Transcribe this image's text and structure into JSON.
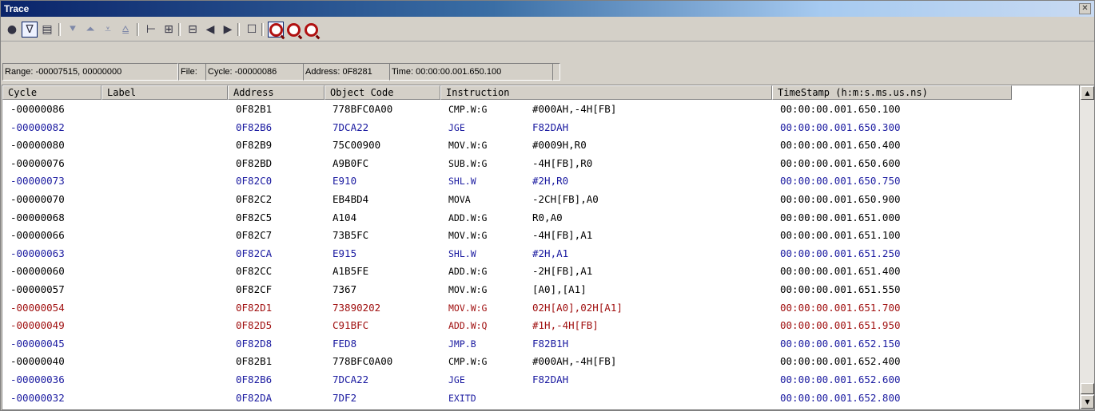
{
  "window": {
    "title": "Trace",
    "close_glyph": "✕"
  },
  "toolbar": {
    "buttons": [
      {
        "name": "record-icon",
        "glyph": "●"
      },
      {
        "name": "filter-icon",
        "glyph": "∇"
      },
      {
        "name": "document-icon",
        "glyph": "▤"
      },
      {
        "name": "step-down-icon",
        "glyph": "⯆"
      },
      {
        "name": "step-up-icon",
        "glyph": "⏶"
      },
      {
        "name": "jump-bottom-icon",
        "glyph": "⩡"
      },
      {
        "name": "jump-top-icon",
        "glyph": "⩠"
      },
      {
        "name": "source-tree-icon",
        "glyph": "⊢"
      },
      {
        "name": "tabular-icon",
        "glyph": "⊞"
      },
      {
        "name": "collapse-icon",
        "glyph": "⊟"
      },
      {
        "name": "prev-icon",
        "glyph": "◀"
      },
      {
        "name": "next-icon",
        "glyph": "▶"
      },
      {
        "name": "properties-icon",
        "glyph": "☐"
      },
      {
        "name": "find-icon",
        "glyph": ""
      },
      {
        "name": "find-prev-icon",
        "glyph": ""
      },
      {
        "name": "find-next-icon",
        "glyph": ""
      }
    ]
  },
  "status": {
    "range": "Range: -00007515, 00000000",
    "file": "File:",
    "cycle": "Cycle: -00000086",
    "address": "Address: 0F8281",
    "time": "Time: 00:00:00.001.650.100"
  },
  "columns": [
    "Cycle",
    "Label",
    "Address",
    "Object Code",
    "Instruction",
    "TimeStamp (h:m:s.ms.us.ns)"
  ],
  "colors": {
    "normal": "#000000",
    "branch": "#1a1aa0",
    "highlight": "#a01010"
  },
  "rows": [
    {
      "cycle": "-00000086",
      "label": "",
      "address": "0F82B1",
      "object": "778BFC0A00",
      "mnemonic": "CMP.W:G",
      "operand": "#000AH,-4H[FB]",
      "timestamp": "00:00:00.001.650.100",
      "style": "normal"
    },
    {
      "cycle": "-00000082",
      "label": "",
      "address": "0F82B6",
      "object": "7DCA22",
      "mnemonic": "JGE",
      "operand": "F82DAH",
      "timestamp": "00:00:00.001.650.300",
      "style": "branch"
    },
    {
      "cycle": "-00000080",
      "label": "",
      "address": "0F82B9",
      "object": "75C00900",
      "mnemonic": "MOV.W:G",
      "operand": "#0009H,R0",
      "timestamp": "00:00:00.001.650.400",
      "style": "normal"
    },
    {
      "cycle": "-00000076",
      "label": "",
      "address": "0F82BD",
      "object": "A9B0FC",
      "mnemonic": "SUB.W:G",
      "operand": "-4H[FB],R0",
      "timestamp": "00:00:00.001.650.600",
      "style": "normal"
    },
    {
      "cycle": "-00000073",
      "label": "",
      "address": "0F82C0",
      "object": "E910",
      "mnemonic": "SHL.W",
      "operand": "#2H,R0",
      "timestamp": "00:00:00.001.650.750",
      "style": "branch"
    },
    {
      "cycle": "-00000070",
      "label": "",
      "address": "0F82C2",
      "object": "EB4BD4",
      "mnemonic": "MOVA",
      "operand": "-2CH[FB],A0",
      "timestamp": "00:00:00.001.650.900",
      "style": "normal"
    },
    {
      "cycle": "-00000068",
      "label": "",
      "address": "0F82C5",
      "object": "A104",
      "mnemonic": "ADD.W:G",
      "operand": "R0,A0",
      "timestamp": "00:00:00.001.651.000",
      "style": "normal"
    },
    {
      "cycle": "-00000066",
      "label": "",
      "address": "0F82C7",
      "object": "73B5FC",
      "mnemonic": "MOV.W:G",
      "operand": "-4H[FB],A1",
      "timestamp": "00:00:00.001.651.100",
      "style": "normal"
    },
    {
      "cycle": "-00000063",
      "label": "",
      "address": "0F82CA",
      "object": "E915",
      "mnemonic": "SHL.W",
      "operand": "#2H,A1",
      "timestamp": "00:00:00.001.651.250",
      "style": "branch"
    },
    {
      "cycle": "-00000060",
      "label": "",
      "address": "0F82CC",
      "object": "A1B5FE",
      "mnemonic": "ADD.W:G",
      "operand": "-2H[FB],A1",
      "timestamp": "00:00:00.001.651.400",
      "style": "normal"
    },
    {
      "cycle": "-00000057",
      "label": "",
      "address": "0F82CF",
      "object": "7367",
      "mnemonic": "MOV.W:G",
      "operand": "[A0],[A1]",
      "timestamp": "00:00:00.001.651.550",
      "style": "normal"
    },
    {
      "cycle": "-00000054",
      "label": "",
      "address": "0F82D1",
      "object": "73890202",
      "mnemonic": "MOV.W:G",
      "operand": "02H[A0],02H[A1]",
      "timestamp": "00:00:00.001.651.700",
      "style": "highlight"
    },
    {
      "cycle": "-00000049",
      "label": "",
      "address": "0F82D5",
      "object": "C91BFC",
      "mnemonic": "ADD.W:Q",
      "operand": "#1H,-4H[FB]",
      "timestamp": "00:00:00.001.651.950",
      "style": "highlight"
    },
    {
      "cycle": "-00000045",
      "label": "",
      "address": "0F82D8",
      "object": "FED8",
      "mnemonic": "JMP.B",
      "operand": "F82B1H",
      "timestamp": "00:00:00.001.652.150",
      "style": "branch"
    },
    {
      "cycle": "-00000040",
      "label": "",
      "address": "0F82B1",
      "object": "778BFC0A00",
      "mnemonic": "CMP.W:G",
      "operand": "#000AH,-4H[FB]",
      "timestamp": "00:00:00.001.652.400",
      "style": "normal"
    },
    {
      "cycle": "-00000036",
      "label": "",
      "address": "0F82B6",
      "object": "7DCA22",
      "mnemonic": "JGE",
      "operand": "F82DAH",
      "timestamp": "00:00:00.001.652.600",
      "style": "branch"
    },
    {
      "cycle": "-00000032",
      "label": "",
      "address": "0F82DA",
      "object": "7DF2",
      "mnemonic": "EXITD",
      "operand": "",
      "timestamp": "00:00:00.001.652.800",
      "style": "branch"
    }
  ]
}
